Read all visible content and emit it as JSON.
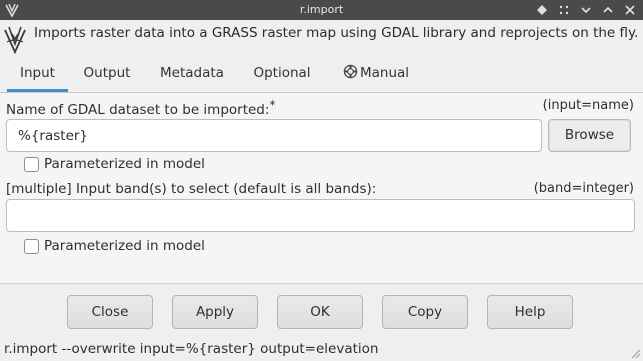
{
  "window": {
    "title": "r.import",
    "icons": {
      "app": "grass-app-icon",
      "controls": [
        "sticky-icon",
        "shade-icon",
        "minimize-icon",
        "maximize-icon",
        "close-icon"
      ]
    }
  },
  "header": {
    "logo": "grass-logo-icon",
    "description": "Imports raster data into a GRASS raster map using GDAL library and reprojects on the fly."
  },
  "tabs": [
    {
      "label": "Input",
      "active": true
    },
    {
      "label": "Output",
      "active": false
    },
    {
      "label": "Metadata",
      "active": false
    },
    {
      "label": "Optional",
      "active": false
    },
    {
      "label": "Manual",
      "active": false,
      "icon": "lifebuoy-icon"
    }
  ],
  "input_tab": {
    "dataset": {
      "label": "Name of GDAL dataset to be imported:",
      "required_mark": "*",
      "hint": "(input=name)",
      "value": "%{raster}",
      "browse_label": "Browse",
      "param_label": "Parameterized in model",
      "param_checked": false
    },
    "band": {
      "label": "[multiple] Input band(s) to select (default is all bands):",
      "hint": "(band=integer)",
      "value": "",
      "param_label": "Parameterized in model",
      "param_checked": false
    }
  },
  "buttons": {
    "close": "Close",
    "apply": "Apply",
    "ok": "OK",
    "copy": "Copy",
    "help": "Help"
  },
  "status": {
    "command": "r.import --overwrite input=%{raster} output=elevation"
  },
  "colors": {
    "titlebar": "#4a4a4a",
    "tab_active_underline": "#3f90c8",
    "panel_bg": "#f5f5f5",
    "window_bg": "#efefef"
  }
}
